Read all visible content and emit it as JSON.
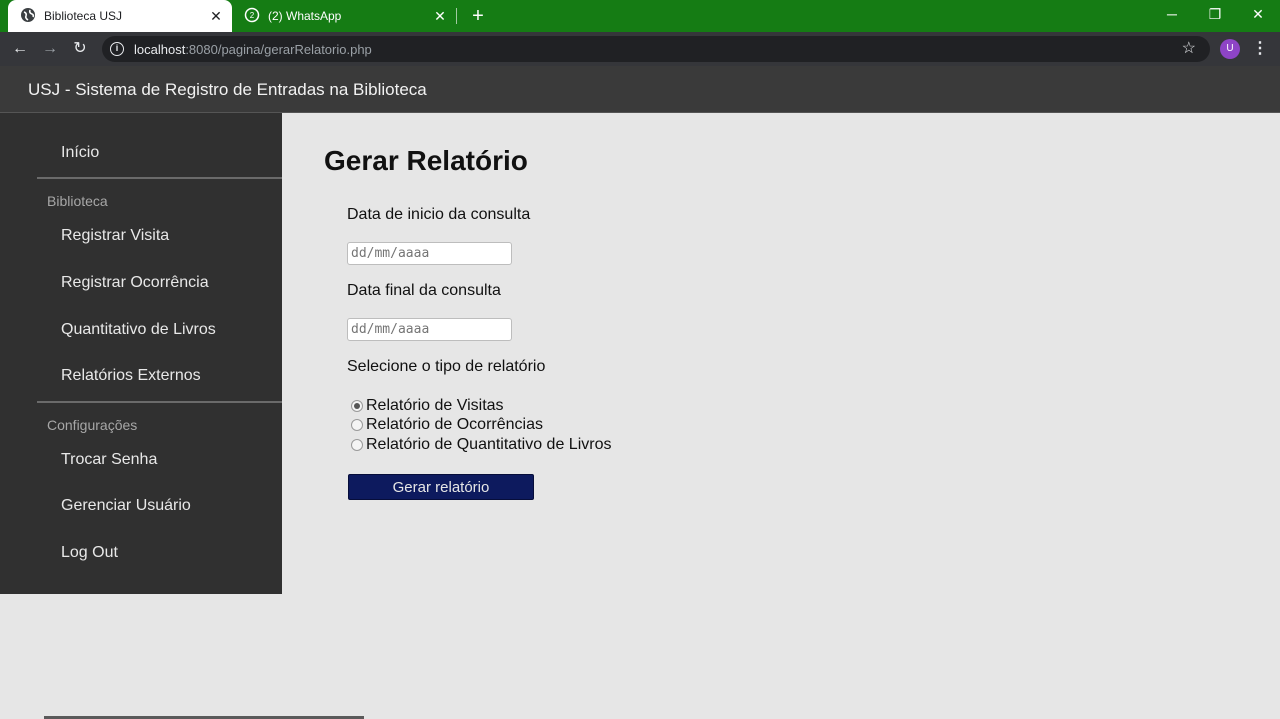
{
  "browser": {
    "tabs": [
      {
        "title": "Biblioteca USJ",
        "icon": "globe-icon",
        "active": true
      },
      {
        "title": "(2) WhatsApp",
        "icon": "whatsapp-icon",
        "active": false
      }
    ],
    "close_glyph": "✕",
    "new_tab_glyph": "+",
    "window_controls": {
      "minimize": "─",
      "restore": "❐",
      "close": "✕"
    },
    "nav": {
      "back": "←",
      "forward": "→",
      "reload": "↻"
    },
    "url_host": "localhost",
    "url_rest": ":8080/pagina/gerarRelatorio.php",
    "star_glyph": "☆",
    "profile_initial": "U",
    "menu_glyph": "⋮",
    "accent_colors": {
      "tabstrip": "#157c14",
      "profile": "#8e44c6"
    }
  },
  "app": {
    "title": "USJ - Sistema de Registro de Entradas na Biblioteca"
  },
  "sidebar": {
    "home": "Início",
    "section_library": "Biblioteca",
    "library_items": [
      "Registrar Visita",
      "Registrar Ocorrência",
      "Quantitativo de Livros",
      "Relatórios Externos"
    ],
    "section_settings": "Configurações",
    "settings_items": [
      "Trocar Senha",
      "Gerenciar Usuário",
      "Log Out"
    ]
  },
  "form": {
    "heading": "Gerar Relatório",
    "start_label": "Data de inicio da consulta",
    "start_placeholder": "dd/mm/aaaa",
    "end_label": "Data final da consulta",
    "end_placeholder": "dd/mm/aaaa",
    "type_label": "Selecione o tipo de relatório",
    "report_types": [
      "Relatório de Visitas",
      "Relatório de Ocorrências",
      "Relatório de Quantitativo de Livros"
    ],
    "selected_report_index": 0,
    "submit_label": "Gerar relatório",
    "submit_color": "#0d1a5e"
  }
}
